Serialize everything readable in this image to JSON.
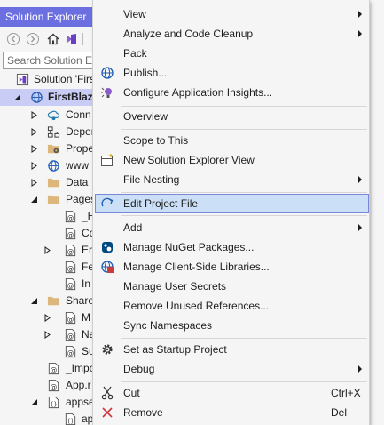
{
  "explorer": {
    "title": "Solution Explorer",
    "search_placeholder": "Search Solution Ex",
    "tree": [
      {
        "label": "Solution 'Firs",
        "icon": "solution-icon"
      },
      {
        "label": "FirstBlaz",
        "icon": "project-icon"
      },
      {
        "label": "Conn",
        "icon": "connected-services-icon"
      },
      {
        "label": "Depen",
        "icon": "dependencies-icon"
      },
      {
        "label": "Prope",
        "icon": "properties-icon"
      },
      {
        "label": "www",
        "icon": "globe-icon"
      },
      {
        "label": "Data",
        "icon": "folder-icon"
      },
      {
        "label": "Pages",
        "icon": "folder-icon"
      },
      {
        "label": "_H",
        "icon": "razor-file-icon"
      },
      {
        "label": "Co",
        "icon": "razor-file-icon"
      },
      {
        "label": "Er",
        "icon": "razor-file-icon"
      },
      {
        "label": "Fe",
        "icon": "razor-file-icon"
      },
      {
        "label": "In",
        "icon": "razor-file-icon"
      },
      {
        "label": "Share",
        "icon": "folder-icon"
      },
      {
        "label": "M",
        "icon": "razor-file-icon"
      },
      {
        "label": "Na",
        "icon": "razor-file-icon"
      },
      {
        "label": "Su",
        "icon": "razor-file-icon"
      },
      {
        "label": "_Impo",
        "icon": "razor-file-icon"
      },
      {
        "label": "App.r",
        "icon": "razor-file-icon"
      },
      {
        "label": "appse",
        "icon": "json-file-icon"
      },
      {
        "label": "ap",
        "icon": "json-file-icon"
      }
    ]
  },
  "menu": {
    "view": "View",
    "analyze": "Analyze and Code Cleanup",
    "pack": "Pack",
    "publish": "Publish...",
    "insights": "Configure Application Insights...",
    "overview": "Overview",
    "scope": "Scope to This",
    "new_view": "New Solution Explorer View",
    "nesting": "File Nesting",
    "edit": "Edit Project File",
    "add": "Add",
    "nuget": "Manage NuGet Packages...",
    "client_libs": "Manage Client-Side Libraries...",
    "secrets": "Manage User Secrets",
    "remove_refs": "Remove Unused References...",
    "sync_ns": "Sync Namespaces",
    "startup": "Set as Startup Project",
    "debug": "Debug",
    "cut": "Cut",
    "cut_shortcut": "Ctrl+X",
    "remove": "Remove",
    "remove_shortcut": "Del"
  },
  "colors": {
    "title_bar": "#6c6fe0",
    "selected_row": "#c9ccf5",
    "menu_highlight": "#cbe0f7",
    "menu_highlight_border": "#7a86d6"
  }
}
